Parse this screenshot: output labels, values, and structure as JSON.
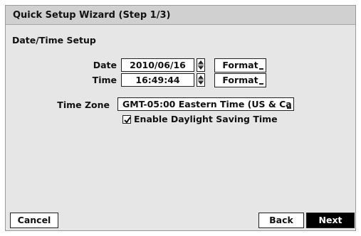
{
  "window": {
    "title": "Quick Setup Wizard (Step 1/3)"
  },
  "section": {
    "title": "Date/Time Setup"
  },
  "date": {
    "label": "Date",
    "value": "2010/06/16",
    "format_label": "Format"
  },
  "time": {
    "label": "Time",
    "value": "16:49:44",
    "format_label": "Format"
  },
  "timezone": {
    "label": "Time Zone",
    "value": "GMT-05:00  Eastern Time (US & Ca"
  },
  "dst": {
    "label": "Enable Daylight Saving Time",
    "checked": true
  },
  "footer": {
    "cancel_label": "Cancel",
    "back_label": "Back",
    "next_label": "Next"
  }
}
